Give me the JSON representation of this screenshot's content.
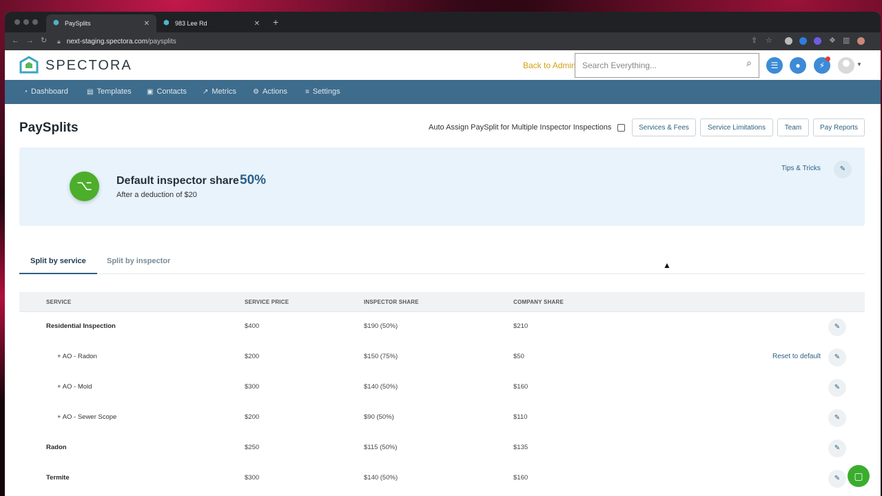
{
  "browser": {
    "tabs": [
      {
        "title": "PaySplits",
        "active": true
      },
      {
        "title": "983 Lee Rd",
        "active": false
      }
    ],
    "url_host": "next-staging.spectora.com",
    "url_path": "/paysplits"
  },
  "header": {
    "logo_text": "SPECTORA",
    "back_to_admin": "Back to Admin",
    "search_placeholder": "Search Everything..."
  },
  "nav": {
    "items": [
      {
        "label": "Dashboard",
        "icon": "dashboard-icon"
      },
      {
        "label": "Templates",
        "icon": "templates-icon"
      },
      {
        "label": "Contacts",
        "icon": "contacts-icon"
      },
      {
        "label": "Metrics",
        "icon": "metrics-icon"
      },
      {
        "label": "Actions",
        "icon": "actions-icon"
      },
      {
        "label": "Settings",
        "icon": "settings-icon"
      }
    ]
  },
  "page": {
    "title": "PaySplits",
    "auto_assign_label": "Auto Assign PaySplit for Multiple Inspector Inspections",
    "buttons": {
      "services_fees": "Services & Fees",
      "service_limitations": "Service Limitations",
      "team": "Team",
      "pay_reports": "Pay Reports"
    }
  },
  "default_share": {
    "heading": "Default inspector share",
    "percent": "50%",
    "subtext": "After a deduction of $20",
    "tips": "Tips & Tricks"
  },
  "tabs": {
    "by_service": "Split by service",
    "by_inspector": "Split by inspector"
  },
  "table": {
    "headers": {
      "service": "SERVICE",
      "price": "SERVICE PRICE",
      "inspector_share": "INSPECTOR SHARE",
      "company_share": "COMPANY SHARE"
    },
    "reset_label": "Reset to default",
    "rows": [
      {
        "service": "Residential Inspection",
        "price": "$400",
        "inspector": "$190 (50%)",
        "company": "$210"
      },
      {
        "service": "+ AO - Radon",
        "price": "$200",
        "inspector": "$150 (75%)",
        "company": "$50"
      },
      {
        "service": "+ AO - Mold",
        "price": "$300",
        "inspector": "$140 (50%)",
        "company": "$160"
      },
      {
        "service": "+ AO - Sewer Scope",
        "price": "$200",
        "inspector": "$90 (50%)",
        "company": "$110"
      },
      {
        "service": "Radon",
        "price": "$250",
        "inspector": "$115 (50%)",
        "company": "$135"
      },
      {
        "service": "Termite",
        "price": "$300",
        "inspector": "$140 (50%)",
        "company": "$160"
      }
    ]
  },
  "colors": {
    "nav_bg": "#3e6c8c",
    "accent_green": "#4cae2a",
    "panel_bg": "#e8f3fb",
    "admin_link": "#d4a017"
  }
}
